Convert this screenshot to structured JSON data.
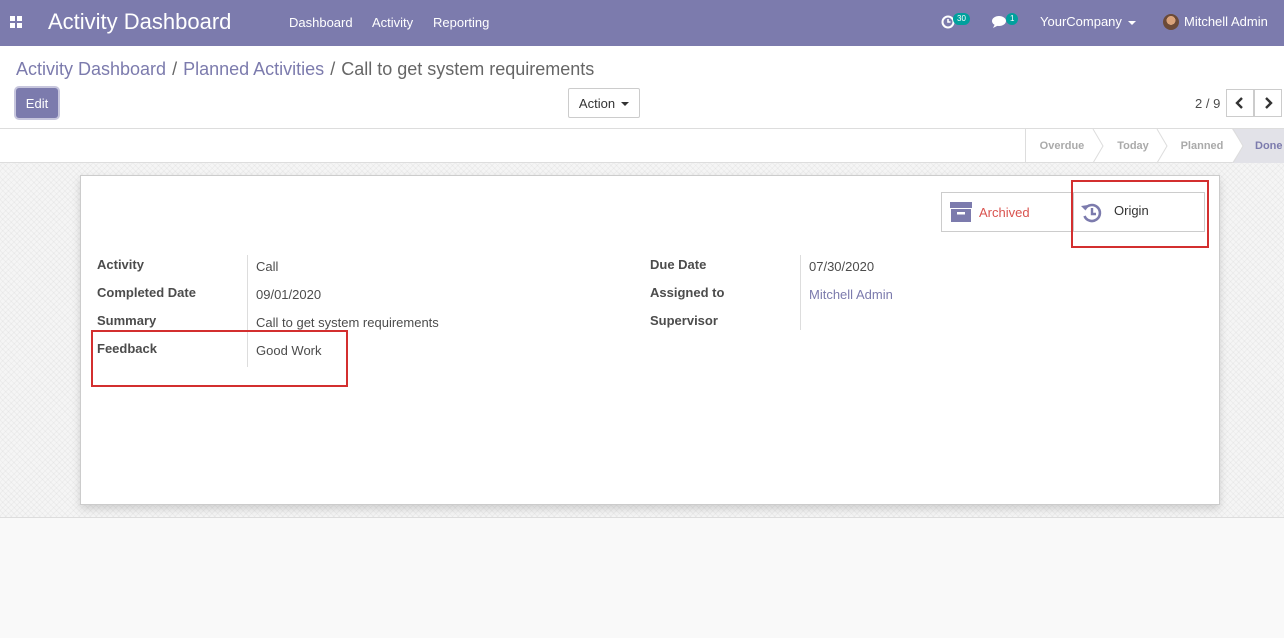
{
  "navbar": {
    "app_title": "Activity Dashboard",
    "menu": [
      "Dashboard",
      "Activity",
      "Reporting"
    ],
    "activity_count": "30",
    "message_count": "1",
    "company": "YourCompany",
    "user": "Mitchell Admin"
  },
  "breadcrumb": {
    "items": [
      "Activity Dashboard",
      "Planned Activities"
    ],
    "current": "Call to get system requirements"
  },
  "buttons": {
    "edit": "Edit",
    "action": "Action"
  },
  "pager": {
    "value": "2 / 9"
  },
  "stages": [
    "Overdue",
    "Today",
    "Planned",
    "Done"
  ],
  "active_stage": "Done",
  "smart_buttons": {
    "archived": "Archived",
    "origin": "Origin"
  },
  "form": {
    "left": [
      {
        "label": "Activity",
        "value": "Call"
      },
      {
        "label": "Completed Date",
        "value": "09/01/2020"
      },
      {
        "label": "Summary",
        "value": "Call to get system requirements"
      },
      {
        "label": "Feedback",
        "value": "Good Work"
      }
    ],
    "right": [
      {
        "label": "Due Date",
        "value": "07/30/2020"
      },
      {
        "label": "Assigned to",
        "value": "Mitchell Admin"
      },
      {
        "label": "Supervisor",
        "value": ""
      }
    ]
  },
  "colors": {
    "brand": "#7c7bad",
    "archived": "#d9534f",
    "highlight": "#d32f2f",
    "badge": "#00a09d"
  }
}
